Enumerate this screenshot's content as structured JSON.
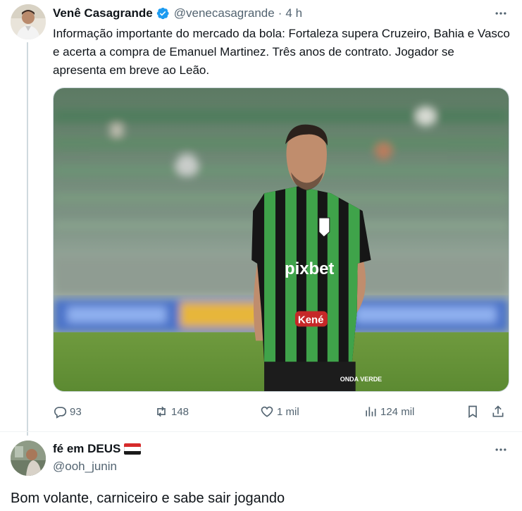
{
  "tweet": {
    "author_name": "Venê Casagrande",
    "verified_icon": "verified-badge-icon",
    "handle": "@venecasagrande",
    "separator": "·",
    "time": "4 h",
    "text": "Informação importante do mercado da bola: Fortaleza supera Cruzeiro, Bahia e Vasco e acerta a compra de Emanuel Martinez. Três anos de contrato. Jogador se apresenta em breve ao Leão.",
    "media": {
      "sponsor_chest": "pixbet",
      "sponsor_belly": "Kené",
      "sponsor_shorts": "ONDA VERDE"
    },
    "stats": {
      "replies": "93",
      "retweets": "148",
      "likes": "1 mil",
      "views": "124 mil"
    }
  },
  "reply": {
    "author_name": "fé em DEUS",
    "handle": "@ooh_junin",
    "text": "Bom volante, carniceiro e sabe sair jogando"
  },
  "colors": {
    "accent": "#1d9bf0",
    "text_secondary": "#536471",
    "border": "#cfd9de",
    "kit_green": "#3fa34a",
    "kit_black": "#161616"
  }
}
